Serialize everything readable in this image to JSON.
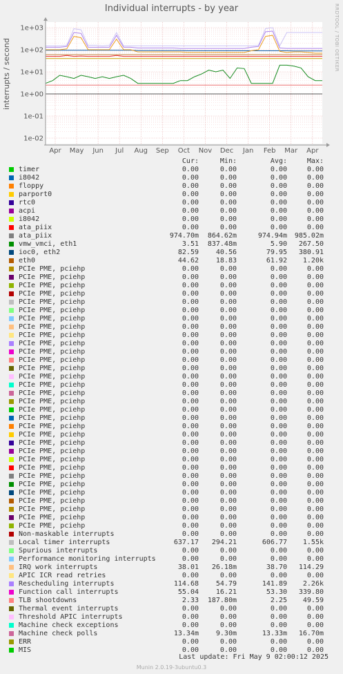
{
  "chart_data": {
    "type": "line",
    "title": "Individual interrupts - by year",
    "ylabel": "interrupts / second",
    "yscale": "log",
    "ylim": [
      0.007,
      1500
    ],
    "y_ticks": [
      "1e+03",
      "1e+02",
      "1e+01",
      "1e+00",
      "1e-01",
      "1e-02"
    ],
    "x_ticks": [
      "Apr",
      "May",
      "Jun",
      "Jul",
      "Aug",
      "Sep",
      "Oct",
      "Nov",
      "Dec",
      "Jan",
      "Feb",
      "Mar",
      "Apr"
    ],
    "grid": true,
    "series": [
      {
        "name": "vmw_vmci, eth1",
        "color": "#ccc4f5",
        "values": [
          150,
          150,
          150,
          160,
          900,
          800,
          160,
          160,
          150,
          160,
          600,
          150,
          150,
          150,
          150,
          150,
          150,
          150,
          150,
          150,
          150,
          150,
          150,
          150,
          150,
          150,
          150,
          150,
          150,
          150,
          160,
          900,
          1000,
          150,
          600,
          600,
          600,
          600,
          600,
          600
        ]
      },
      {
        "name": "Rescheduling interrupts",
        "color": "#a97fea",
        "values": [
          130,
          130,
          130,
          140,
          600,
          550,
          130,
          130,
          130,
          130,
          450,
          130,
          130,
          120,
          120,
          120,
          120,
          120,
          120,
          115,
          115,
          115,
          115,
          115,
          115,
          115,
          115,
          115,
          115,
          130,
          140,
          650,
          700,
          120,
          115,
          115,
          115,
          115,
          115,
          115
        ]
      },
      {
        "name": "ioc0, eth2",
        "color": "#0e5fa8",
        "values": [
          95,
          95,
          95,
          95,
          95,
          95,
          95,
          95,
          95,
          95,
          95,
          95,
          95,
          92,
          92,
          92,
          92,
          92,
          92,
          92,
          90,
          90,
          90,
          90,
          90,
          90,
          90,
          90,
          90,
          90,
          90,
          90,
          90,
          90,
          90,
          88,
          88,
          88,
          88,
          88
        ]
      },
      {
        "name": "Local timer interrupts",
        "color": "#eb9d21",
        "values": [
          100,
          100,
          100,
          110,
          400,
          350,
          100,
          100,
          100,
          100,
          300,
          100,
          100,
          80,
          80,
          80,
          80,
          80,
          80,
          80,
          75,
          75,
          75,
          75,
          75,
          75,
          75,
          75,
          75,
          90,
          100,
          400,
          450,
          85,
          75,
          80,
          80,
          75,
          70,
          70
        ]
      },
      {
        "name": "eth0",
        "color": "#c17f3a",
        "values": [
          60,
          60,
          60,
          60,
          60,
          60,
          60,
          60,
          60,
          60,
          60,
          60,
          60,
          60,
          60,
          60,
          60,
          60,
          60,
          60,
          60,
          60,
          60,
          60,
          60,
          60,
          60,
          60,
          60,
          60,
          60,
          60,
          60,
          60,
          60,
          60,
          60,
          60,
          60,
          60
        ]
      },
      {
        "name": "Function call interrupts",
        "color": "#e62828",
        "values": [
          50,
          50,
          50,
          55,
          50,
          52,
          50,
          50,
          50,
          50,
          55,
          50,
          50,
          50,
          50,
          50,
          50,
          50,
          50,
          50,
          50,
          50,
          50,
          50,
          50,
          50,
          50,
          50,
          50,
          50,
          50,
          50,
          50,
          50,
          50,
          50,
          50,
          50,
          50,
          50
        ]
      },
      {
        "name": "IRQ work interrupts",
        "color": "#c8a000",
        "values": [
          40,
          40,
          40,
          40,
          40,
          40,
          40,
          40,
          40,
          40,
          40,
          40,
          40,
          40,
          40,
          40,
          40,
          40,
          40,
          40,
          40,
          40,
          40,
          40,
          40,
          40,
          40,
          40,
          40,
          40,
          40,
          40,
          40,
          40,
          40,
          40,
          40,
          40,
          40,
          40
        ]
      },
      {
        "name": "PCIe PME, pciehp",
        "color": "#158a1e",
        "values": [
          3,
          4,
          7,
          6,
          5,
          7,
          6,
          5,
          6,
          5,
          6,
          7,
          5,
          3,
          3,
          3,
          3,
          3,
          3,
          4,
          4,
          6,
          8,
          12,
          10,
          12,
          5,
          15,
          14,
          3,
          3,
          3,
          3,
          20,
          20,
          18,
          15,
          6,
          4,
          4
        ]
      },
      {
        "name": "TLB shootdowns",
        "color": "#ee7070",
        "values": [
          2.5,
          2.5,
          2.5,
          2.5,
          2.5,
          2.5,
          2.5,
          2.5,
          2.5,
          2.5,
          2.5,
          2.5,
          2.5,
          2.5,
          2.5,
          2.5,
          2.5,
          2.5,
          2.5,
          2.5,
          2.5,
          2.5,
          2.5,
          2.5,
          2.5,
          2.5,
          2.5,
          2.5,
          2.5,
          2.5,
          2.5,
          2.5,
          2.5,
          2.5,
          2.5,
          2.5,
          2.5,
          2.5,
          2.5,
          2.5
        ]
      },
      {
        "name": "ata_piix",
        "color": "#555555",
        "values": [
          1,
          1,
          1,
          1,
          1,
          1,
          1,
          1,
          1,
          1,
          1,
          1,
          1,
          1,
          1,
          1,
          1,
          1,
          1,
          1,
          1,
          1,
          1,
          1,
          1,
          1,
          1,
          1,
          1,
          1,
          1,
          1,
          1,
          1,
          1,
          1,
          1,
          1,
          1,
          1
        ]
      }
    ]
  },
  "legend_header": {
    "cur": "Cur:",
    "min": "Min:",
    "avg": "Avg:",
    "max": "Max:"
  },
  "legend": [
    {
      "label": "timer",
      "color": "#00cc00",
      "cur": "0.00",
      "min": "0.00",
      "avg": "0.00",
      "max": "0.00"
    },
    {
      "label": "i8042",
      "color": "#0066b3",
      "cur": "0.00",
      "min": "0.00",
      "avg": "0.00",
      "max": "0.00"
    },
    {
      "label": "floppy",
      "color": "#ff8000",
      "cur": "0.00",
      "min": "0.00",
      "avg": "0.00",
      "max": "0.00"
    },
    {
      "label": "parport0",
      "color": "#ffcc00",
      "cur": "0.00",
      "min": "0.00",
      "avg": "0.00",
      "max": "0.00"
    },
    {
      "label": "rtc0",
      "color": "#330099",
      "cur": "0.00",
      "min": "0.00",
      "avg": "0.00",
      "max": "0.00"
    },
    {
      "label": "acpi",
      "color": "#990099",
      "cur": "0.00",
      "min": "0.00",
      "avg": "0.00",
      "max": "0.00"
    },
    {
      "label": "i8042",
      "color": "#ccff00",
      "cur": "0.00",
      "min": "0.00",
      "avg": "0.00",
      "max": "0.00"
    },
    {
      "label": "ata_piix",
      "color": "#ff0000",
      "cur": "0.00",
      "min": "0.00",
      "avg": "0.00",
      "max": "0.00"
    },
    {
      "label": "ata_piix",
      "color": "#808080",
      "cur": "974.70m",
      "min": "864.62m",
      "avg": "974.94m",
      "max": "985.02m"
    },
    {
      "label": "vmw_vmci, eth1",
      "color": "#008f00",
      "cur": "3.51",
      "min": "837.48m",
      "avg": "5.90",
      "max": "267.50"
    },
    {
      "label": "ioc0, eth2",
      "color": "#00487d",
      "cur": "82.59",
      "min": "40.56",
      "avg": "79.95",
      "max": "380.91"
    },
    {
      "label": "eth0",
      "color": "#b35a00",
      "cur": "44.62",
      "min": "18.83",
      "avg": "61.92",
      "max": "1.20k"
    },
    {
      "label": "PCIe PME, pciehp",
      "color": "#b38f00",
      "cur": "0.00",
      "min": "0.00",
      "avg": "0.00",
      "max": "0.00"
    },
    {
      "label": "PCIe PME, pciehp",
      "color": "#6b006b",
      "cur": "0.00",
      "min": "0.00",
      "avg": "0.00",
      "max": "0.00"
    },
    {
      "label": "PCIe PME, pciehp",
      "color": "#8fb300",
      "cur": "0.00",
      "min": "0.00",
      "avg": "0.00",
      "max": "0.00"
    },
    {
      "label": "PCIe PME, pciehp",
      "color": "#b30000",
      "cur": "0.00",
      "min": "0.00",
      "avg": "0.00",
      "max": "0.00"
    },
    {
      "label": "PCIe PME, pciehp",
      "color": "#bebebe",
      "cur": "0.00",
      "min": "0.00",
      "avg": "0.00",
      "max": "0.00"
    },
    {
      "label": "PCIe PME, pciehp",
      "color": "#80ff80",
      "cur": "0.00",
      "min": "0.00",
      "avg": "0.00",
      "max": "0.00"
    },
    {
      "label": "PCIe PME, pciehp",
      "color": "#80c9ff",
      "cur": "0.00",
      "min": "0.00",
      "avg": "0.00",
      "max": "0.00"
    },
    {
      "label": "PCIe PME, pciehp",
      "color": "#ffc080",
      "cur": "0.00",
      "min": "0.00",
      "avg": "0.00",
      "max": "0.00"
    },
    {
      "label": "PCIe PME, pciehp",
      "color": "#ffe680",
      "cur": "0.00",
      "min": "0.00",
      "avg": "0.00",
      "max": "0.00"
    },
    {
      "label": "PCIe PME, pciehp",
      "color": "#aa80ff",
      "cur": "0.00",
      "min": "0.00",
      "avg": "0.00",
      "max": "0.00"
    },
    {
      "label": "PCIe PME, pciehp",
      "color": "#ee00cc",
      "cur": "0.00",
      "min": "0.00",
      "avg": "0.00",
      "max": "0.00"
    },
    {
      "label": "PCIe PME, pciehp",
      "color": "#ff8080",
      "cur": "0.00",
      "min": "0.00",
      "avg": "0.00",
      "max": "0.00"
    },
    {
      "label": "PCIe PME, pciehp",
      "color": "#666600",
      "cur": "0.00",
      "min": "0.00",
      "avg": "0.00",
      "max": "0.00"
    },
    {
      "label": "PCIe PME, pciehp",
      "color": "#ffbfff",
      "cur": "0.00",
      "min": "0.00",
      "avg": "0.00",
      "max": "0.00"
    },
    {
      "label": "PCIe PME, pciehp",
      "color": "#00ffcc",
      "cur": "0.00",
      "min": "0.00",
      "avg": "0.00",
      "max": "0.00"
    },
    {
      "label": "PCIe PME, pciehp",
      "color": "#cc6699",
      "cur": "0.00",
      "min": "0.00",
      "avg": "0.00",
      "max": "0.00"
    },
    {
      "label": "PCIe PME, pciehp",
      "color": "#999900",
      "cur": "0.00",
      "min": "0.00",
      "avg": "0.00",
      "max": "0.00"
    },
    {
      "label": "PCIe PME, pciehp",
      "color": "#00cc00",
      "cur": "0.00",
      "min": "0.00",
      "avg": "0.00",
      "max": "0.00"
    },
    {
      "label": "PCIe PME, pciehp",
      "color": "#0066b3",
      "cur": "0.00",
      "min": "0.00",
      "avg": "0.00",
      "max": "0.00"
    },
    {
      "label": "PCIe PME, pciehp",
      "color": "#ff8000",
      "cur": "0.00",
      "min": "0.00",
      "avg": "0.00",
      "max": "0.00"
    },
    {
      "label": "PCIe PME, pciehp",
      "color": "#ffcc00",
      "cur": "0.00",
      "min": "0.00",
      "avg": "0.00",
      "max": "0.00"
    },
    {
      "label": "PCIe PME, pciehp",
      "color": "#330099",
      "cur": "0.00",
      "min": "0.00",
      "avg": "0.00",
      "max": "0.00"
    },
    {
      "label": "PCIe PME, pciehp",
      "color": "#990099",
      "cur": "0.00",
      "min": "0.00",
      "avg": "0.00",
      "max": "0.00"
    },
    {
      "label": "PCIe PME, pciehp",
      "color": "#ccff00",
      "cur": "0.00",
      "min": "0.00",
      "avg": "0.00",
      "max": "0.00"
    },
    {
      "label": "PCIe PME, pciehp",
      "color": "#ff0000",
      "cur": "0.00",
      "min": "0.00",
      "avg": "0.00",
      "max": "0.00"
    },
    {
      "label": "PCIe PME, pciehp",
      "color": "#808080",
      "cur": "0.00",
      "min": "0.00",
      "avg": "0.00",
      "max": "0.00"
    },
    {
      "label": "PCIe PME, pciehp",
      "color": "#008f00",
      "cur": "0.00",
      "min": "0.00",
      "avg": "0.00",
      "max": "0.00"
    },
    {
      "label": "PCIe PME, pciehp",
      "color": "#00487d",
      "cur": "0.00",
      "min": "0.00",
      "avg": "0.00",
      "max": "0.00"
    },
    {
      "label": "PCIe PME, pciehp",
      "color": "#b35a00",
      "cur": "0.00",
      "min": "0.00",
      "avg": "0.00",
      "max": "0.00"
    },
    {
      "label": "PCIe PME, pciehp",
      "color": "#b38f00",
      "cur": "0.00",
      "min": "0.00",
      "avg": "0.00",
      "max": "0.00"
    },
    {
      "label": "PCIe PME, pciehp",
      "color": "#6b006b",
      "cur": "0.00",
      "min": "0.00",
      "avg": "0.00",
      "max": "0.00"
    },
    {
      "label": "PCIe PME, pciehp",
      "color": "#8fb300",
      "cur": "0.00",
      "min": "0.00",
      "avg": "0.00",
      "max": "0.00"
    },
    {
      "label": "Non-maskable interrupts",
      "color": "#b30000",
      "cur": "0.00",
      "min": "0.00",
      "avg": "0.00",
      "max": "0.00"
    },
    {
      "label": "Local timer interrupts",
      "color": "#bebebe",
      "cur": "637.17",
      "min": "294.21",
      "avg": "606.77",
      "max": "1.55k"
    },
    {
      "label": "Spurious interrupts",
      "color": "#80ff80",
      "cur": "0.00",
      "min": "0.00",
      "avg": "0.00",
      "max": "0.00"
    },
    {
      "label": "Performance monitoring interrupts",
      "color": "#80c9ff",
      "cur": "0.00",
      "min": "0.00",
      "avg": "0.00",
      "max": "0.00"
    },
    {
      "label": "IRQ work interrupts",
      "color": "#ffc080",
      "cur": "38.01",
      "min": "26.18m",
      "avg": "38.70",
      "max": "114.29"
    },
    {
      "label": "APIC ICR read retries",
      "color": "#ffe680",
      "cur": "0.00",
      "min": "0.00",
      "avg": "0.00",
      "max": "0.00"
    },
    {
      "label": "Rescheduling interrupts",
      "color": "#aa80ff",
      "cur": "114.68",
      "min": "54.79",
      "avg": "141.89",
      "max": "2.26k"
    },
    {
      "label": "Function call interrupts",
      "color": "#ee00cc",
      "cur": "55.04",
      "min": "16.21",
      "avg": "53.30",
      "max": "339.80"
    },
    {
      "label": "TLB shootdowns",
      "color": "#ff8080",
      "cur": "2.33",
      "min": "187.80m",
      "avg": "2.25",
      "max": "49.59"
    },
    {
      "label": "Thermal event interrupts",
      "color": "#666600",
      "cur": "0.00",
      "min": "0.00",
      "avg": "0.00",
      "max": "0.00"
    },
    {
      "label": "Threshold APIC interrupts",
      "color": "#ffbfff",
      "cur": "0.00",
      "min": "0.00",
      "avg": "0.00",
      "max": "0.00"
    },
    {
      "label": "Machine check exceptions",
      "color": "#00ffcc",
      "cur": "0.00",
      "min": "0.00",
      "avg": "0.00",
      "max": "0.00"
    },
    {
      "label": "Machine check polls",
      "color": "#cc6699",
      "cur": "13.34m",
      "min": "9.30m",
      "avg": "13.33m",
      "max": "16.70m"
    },
    {
      "label": "ERR",
      "color": "#999900",
      "cur": "0.00",
      "min": "0.00",
      "avg": "0.00",
      "max": "0.00"
    },
    {
      "label": "MIS",
      "color": "#00cc00",
      "cur": "0.00",
      "min": "0.00",
      "avg": "0.00",
      "max": "0.00"
    }
  ],
  "last_update": "Last update:  Fri May  9 02:00:12 2025",
  "side_text": "RRDTOOL / TOBI OETIKER",
  "footer": "Munin 2.0.19-3ubuntu0.3"
}
